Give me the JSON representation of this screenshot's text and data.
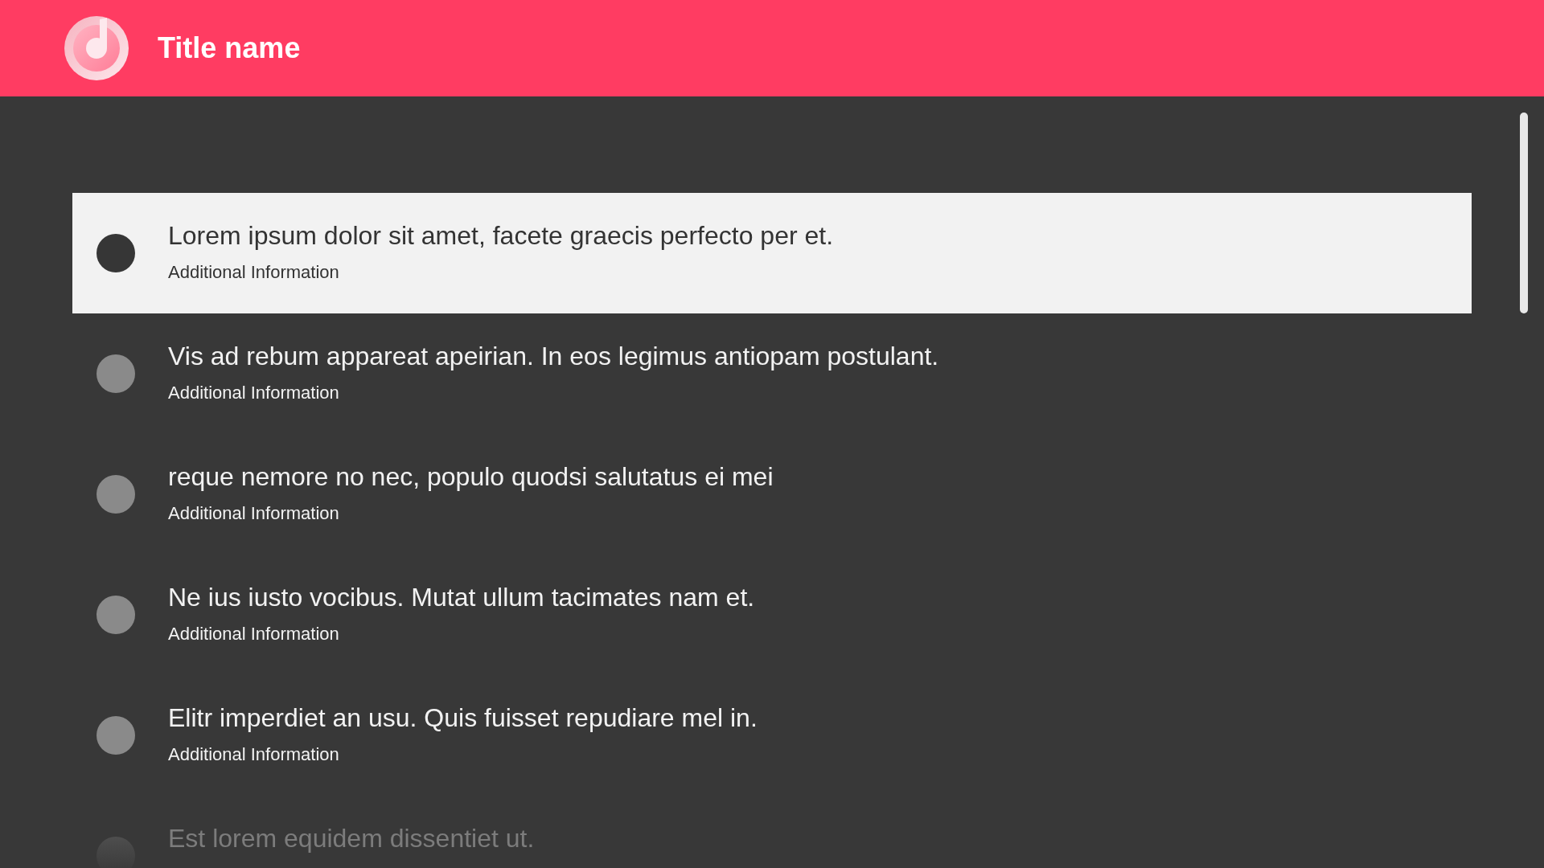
{
  "header": {
    "title": "Title name"
  },
  "list": {
    "items": [
      {
        "text": "Lorem ipsum dolor sit amet, facete graecis perfecto per et.",
        "sub": "Additional Information",
        "selected": true
      },
      {
        "text": "Vis ad rebum appareat apeirian. In eos legimus antiopam postulant.",
        "sub": "Additional Information",
        "selected": false
      },
      {
        "text": "reque nemore no nec, populo quodsi salutatus ei mei",
        "sub": "Additional Information",
        "selected": false
      },
      {
        "text": "Ne ius iusto vocibus. Mutat ullum tacimates nam et.",
        "sub": "Additional Information",
        "selected": false
      },
      {
        "text": "Elitr imperdiet an usu. Quis fuisset repudiare mel in.",
        "sub": "Additional Information",
        "selected": false
      },
      {
        "text": "Est lorem equidem dissentiet ut.",
        "selected": false
      }
    ]
  }
}
